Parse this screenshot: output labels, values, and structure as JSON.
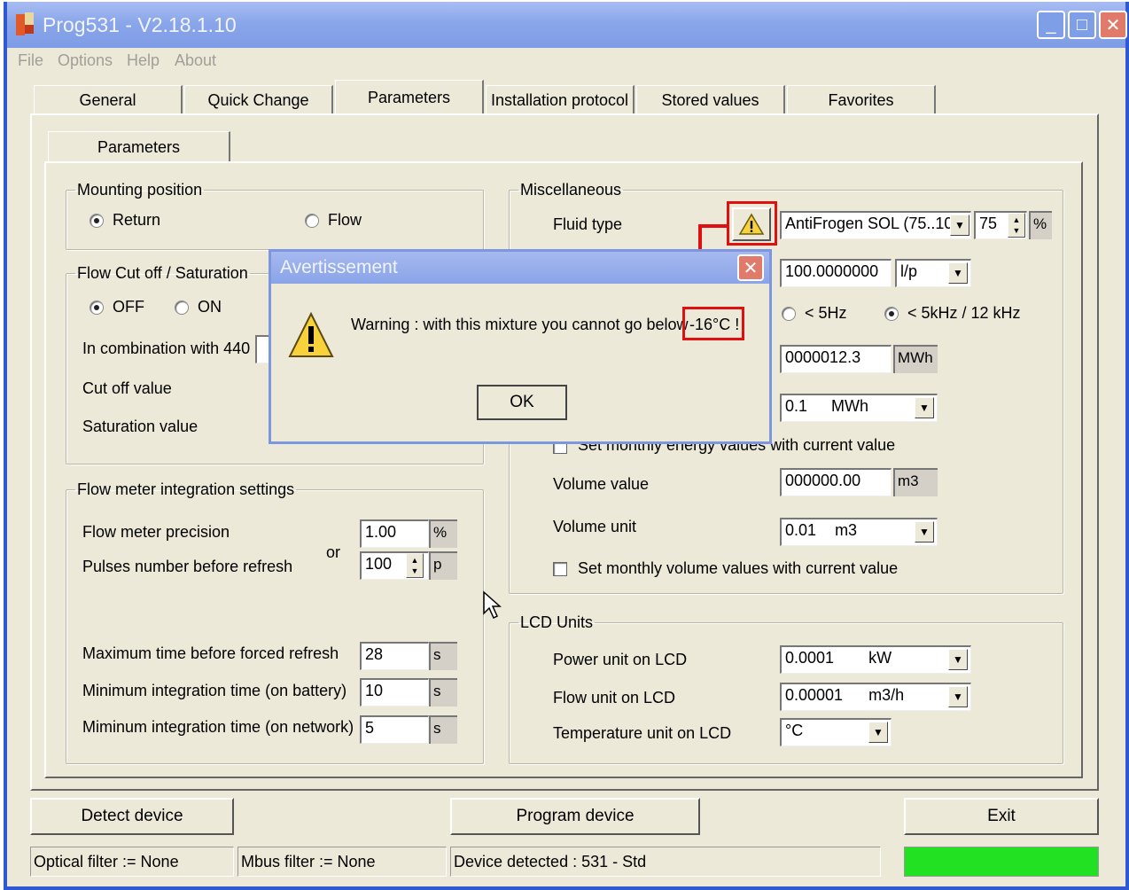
{
  "window": {
    "title": "Prog531 - V2.18.1.10",
    "controls": {
      "minimize": "_",
      "maximize": "□",
      "close": "✕"
    }
  },
  "menu": [
    "File",
    "Options",
    "Help",
    "About"
  ],
  "tabs": [
    "General",
    "Quick Change",
    "Parameters",
    "Installation protocol",
    "Stored values",
    "Favorites"
  ],
  "active_tab": "Parameters",
  "subtab": "Parameters",
  "mounting": {
    "legend": "Mounting position",
    "return_label": "Return",
    "flow_label": "Flow",
    "selected": "Return"
  },
  "flowcut": {
    "legend": "Flow Cut off / Saturation",
    "off_label": "OFF",
    "on_label": "ON",
    "selected": "OFF",
    "combination_label": "In combination with 440 :",
    "cutoff_label": "Cut off value",
    "saturation_label": "Saturation value"
  },
  "integration": {
    "legend": "Flow meter integration settings",
    "precision_label": "Flow meter precision",
    "precision_value": "1.00",
    "precision_unit": "%",
    "or_label": "or",
    "pulses_label": "Pulses number before refresh",
    "pulses_value": "100",
    "pulses_unit": "p",
    "maxtime_label": "Maximum time before forced refresh",
    "maxtime_value": "28",
    "maxtime_unit": "s",
    "minbattery_label": "Minimum integration time (on battery)",
    "minbattery_value": "10",
    "minbattery_unit": "s",
    "minnetwork_label": "Miminum integration time (on network)",
    "minnetwork_value": "5",
    "minnetwork_unit": "s"
  },
  "misc": {
    "legend": "Miscellaneous",
    "fluid_label": "Fluid type",
    "fluid_value": "AntiFrogen SOL (75..10I",
    "fluid_percent": "75",
    "fluid_percent_unit": "%",
    "pulse_value": "100.0000000",
    "pulse_unit": "l/p",
    "freq_5hz": "< 5Hz",
    "freq_5khz": "< 5kHz / 12 kHz",
    "freq_selected": "< 5kHz / 12 kHz",
    "energy_value": "0000012.3",
    "energy_unit": "MWh",
    "energy_res_value": "0.1",
    "energy_res_unit": "MWh",
    "set_energy_label": "Set monthly energy values with current value",
    "volume_label": "Volume value",
    "volume_value": "000000.00",
    "volume_unit": "m3",
    "volunit_label": "Volume unit",
    "volunit_value": "0.01",
    "volunit_unit": "m3",
    "set_volume_label": "Set monthly volume values with current value"
  },
  "lcd": {
    "legend": "LCD Units",
    "power_label": "Power unit on LCD",
    "power_value": "0.0001",
    "power_unit": "kW",
    "flow_label": "Flow unit on LCD",
    "flow_value": "0.00001",
    "flow_unit": "m3/h",
    "temp_label": "Temperature unit on LCD",
    "temp_value": "°C"
  },
  "buttons": {
    "detect": "Detect device",
    "program": "Program device",
    "exit": "Exit"
  },
  "status": {
    "optical": "Optical filter := None",
    "mbus": "Mbus filter := None",
    "device": "Device detected : 531 - Std",
    "indicator_color": "#22e022"
  },
  "dialog": {
    "title": "Avertissement",
    "message": "Warning : with this mixture you cannot go below",
    "highlight": "-16°C !",
    "ok": "OK"
  },
  "colors": {
    "highlight_red": "#e01010",
    "titlebar_blue": "#2e59d3"
  }
}
